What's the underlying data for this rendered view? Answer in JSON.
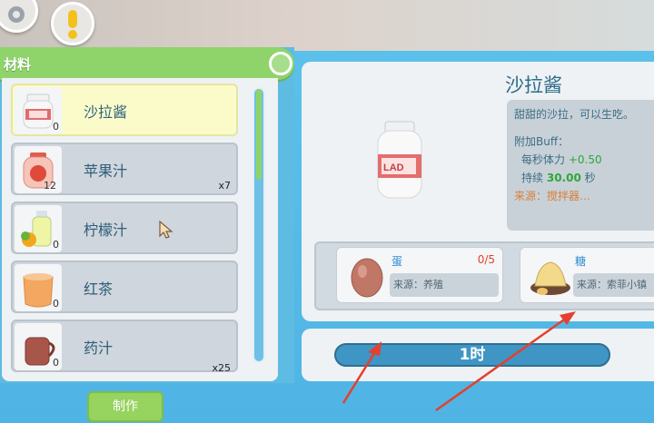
{
  "panel": {
    "title": "材料",
    "items": [
      {
        "label": "沙拉酱",
        "count": "0",
        "qty": "",
        "selected": true,
        "icon": "mayo-jar-icon"
      },
      {
        "label": "苹果汁",
        "count": "12",
        "qty": "x7",
        "selected": false,
        "icon": "apple-juice-icon"
      },
      {
        "label": "柠檬汁",
        "count": "0",
        "qty": "",
        "selected": false,
        "icon": "lemon-juice-icon"
      },
      {
        "label": "红茶",
        "count": "0",
        "qty": "",
        "selected": false,
        "icon": "black-tea-icon"
      },
      {
        "label": "药汁",
        "count": "0",
        "qty": "x25",
        "selected": false,
        "icon": "medicine-icon"
      }
    ],
    "make_button": "制作"
  },
  "detail": {
    "title": "沙拉酱",
    "jar_label": "LAD",
    "description": "甜甜的沙拉，可以生吃。",
    "buff_label": "附加Buff：",
    "buff_stat_label": "每秒体力",
    "buff_stat_value": "+0.50",
    "duration_label": "持续",
    "duration_value": "30.00",
    "duration_unit": "秒",
    "source_text": "来源：搅拌器…"
  },
  "ingredients": [
    {
      "name": "蛋",
      "count": "0/5",
      "source": "来源：养殖",
      "icon": "egg-icon"
    },
    {
      "name": "糖",
      "count": "",
      "source": "来源：索菲小镇",
      "icon": "sugar-icon"
    }
  ],
  "time": {
    "label": "1时"
  },
  "colors": {
    "accent_green": "#8fd46a",
    "panel_blue": "#4fb4e4",
    "annotation_red": "#e4402f"
  }
}
